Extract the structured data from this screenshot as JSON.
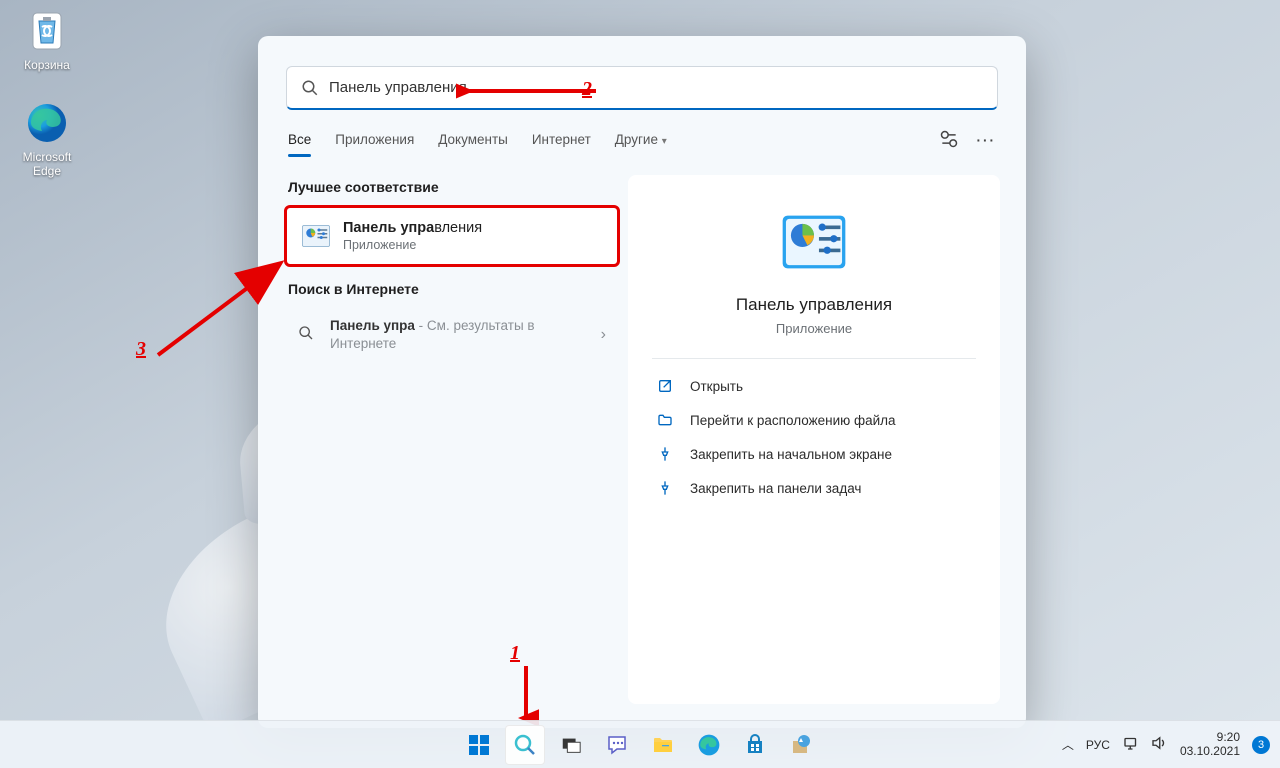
{
  "desktop": {
    "recycle_bin": "Корзина",
    "edge": "Microsoft Edge"
  },
  "search": {
    "query": "Панель управления",
    "tabs": [
      "Все",
      "Приложения",
      "Документы",
      "Интернет",
      "Другие"
    ],
    "best_match_header": "Лучшее соответствие",
    "best_match": {
      "title_bold": "Панель упра",
      "title_rest": "вления",
      "subtitle": "Приложение"
    },
    "web_header": "Поиск в Интернете",
    "web_result": {
      "prefix": "Панель упра",
      "suffix": " - См. результаты в Интернете"
    },
    "preview": {
      "title": "Панель управления",
      "subtitle": "Приложение",
      "actions": [
        "Открыть",
        "Перейти к расположению файла",
        "Закрепить на начальном экране",
        "Закрепить на панели задач"
      ]
    }
  },
  "taskbar": {
    "lang": "РУС",
    "time": "9:20",
    "date": "03.10.2021",
    "notif_count": "3"
  },
  "annotations": {
    "one": "1",
    "two": "2",
    "three": "3"
  }
}
